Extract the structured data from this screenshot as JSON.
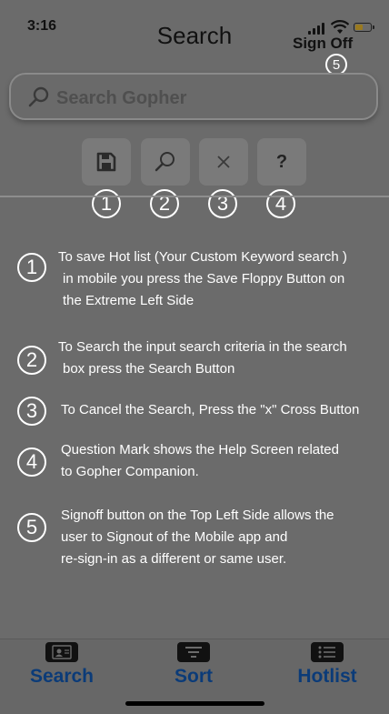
{
  "status_bar": {
    "time": "3:16"
  },
  "header": {
    "title": "Search",
    "sign_off_label": "Sign Off",
    "sign_off_marker": "5"
  },
  "search": {
    "placeholder": "Search Gopher"
  },
  "toolbar": {
    "buttons": [
      {
        "icon": "floppy-disk-icon",
        "marker": "1"
      },
      {
        "icon": "search-icon",
        "marker": "2"
      },
      {
        "icon": "close-icon",
        "marker": "3"
      },
      {
        "icon": "question-mark-icon",
        "label": "?",
        "marker": "4"
      }
    ]
  },
  "help": {
    "items": [
      {
        "marker": "1",
        "lines": [
          "To save  Hot list (Your Custom Keyword search )",
          "in mobile you press the Save Floppy Button on",
          "the Extreme Left Side"
        ]
      },
      {
        "marker": "2",
        "lines": [
          "To  Search  the input search criteria in the search",
          "box press the Search Button"
        ]
      },
      {
        "marker": "3",
        "lines": [
          "To Cancel the Search, Press the \"x\" Cross Button"
        ]
      },
      {
        "marker": "4",
        "lines": [
          "Question Mark shows the  Help Screen related",
          "to Gopher Companion."
        ]
      },
      {
        "marker": "5",
        "lines": [
          "Signoff button on the Top Left Side allows the",
          "user to Signout of the Mobile app and",
          "re-sign-in as a different or same user."
        ]
      }
    ]
  },
  "tabbar": {
    "tabs": [
      {
        "label": "Search",
        "icon": "contact-card-icon"
      },
      {
        "label": "Sort",
        "icon": "sort-lines-icon"
      },
      {
        "label": "Hotlist",
        "icon": "list-icon"
      }
    ]
  },
  "colors": {
    "overlay": "#6b6b6b",
    "tab_label": "#0b3b78",
    "marker": "#ffffff"
  }
}
